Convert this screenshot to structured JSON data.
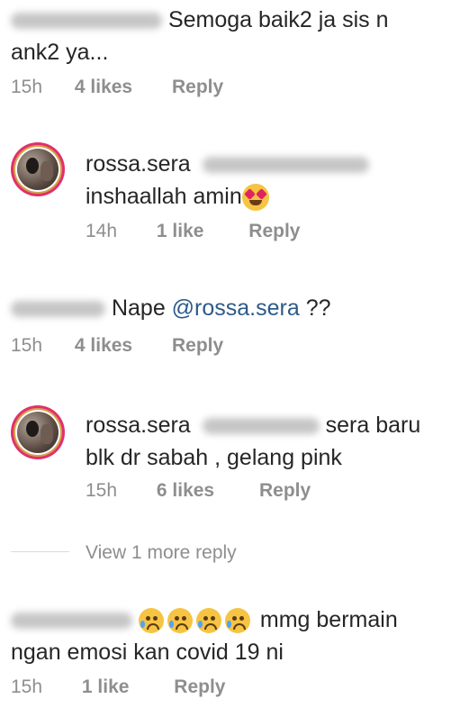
{
  "comments": [
    {
      "text_part1": "Semoga baik2 ja sis n",
      "text_part2": "ank2 ya...",
      "time": "15h",
      "likes": "4 likes",
      "reply": "Reply"
    },
    {
      "username": "rossa.sera",
      "text": "inshaallah amin",
      "time": "14h",
      "likes": "1 like",
      "reply": "Reply"
    },
    {
      "text_prefix": "Nape",
      "mention": "@rossa.sera",
      "text_suffix": "??",
      "time": "15h",
      "likes": "4 likes",
      "reply": "Reply"
    },
    {
      "username": "rossa.sera",
      "text_part1": "sera baru",
      "text_part2": "blk dr sabah , gelang pink",
      "time": "15h",
      "likes": "6 likes",
      "reply": "Reply"
    },
    {
      "view_more": "View 1 more reply"
    },
    {
      "text_part1": "mmg bermain",
      "text_part2": "ngan emosi kan covid 19 ni",
      "time": "15h",
      "likes": "1 like",
      "reply": "Reply"
    }
  ],
  "icons": {
    "heart_eyes": "smiling-face-with-heart-eyes-icon",
    "crying": "crying-face-icon"
  }
}
